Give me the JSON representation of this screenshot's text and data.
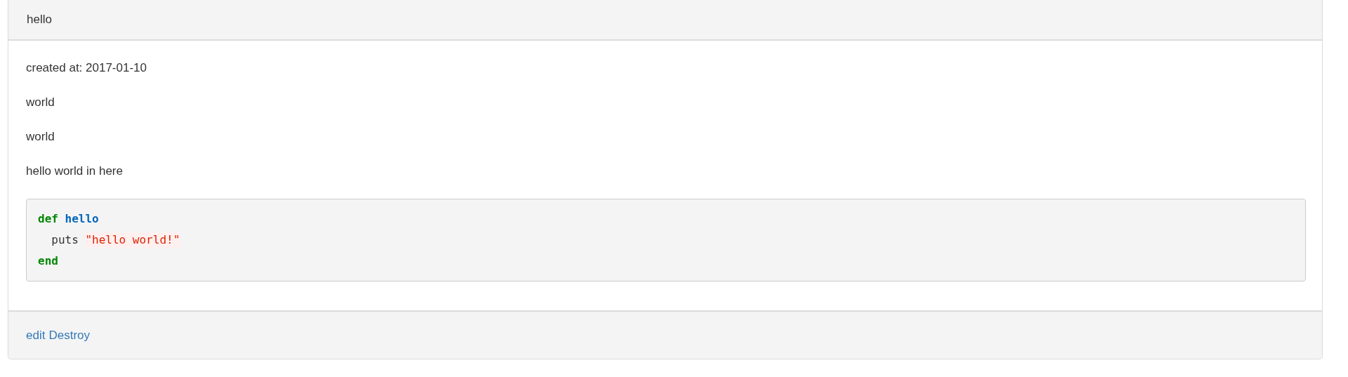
{
  "panel": {
    "title": "hello",
    "lines": [
      "created at: 2017-01-10",
      "world",
      "world",
      "hello world in here"
    ],
    "code": [
      [
        {
          "kind": "keyword",
          "text": "def"
        },
        {
          "kind": "name",
          "text": "hello"
        }
      ],
      [
        {
          "kind": "plain",
          "text": "  puts"
        },
        {
          "kind": "string",
          "text": "\"hello world!\""
        }
      ],
      [
        {
          "kind": "keyword",
          "text": "end"
        }
      ]
    ],
    "footer_links": [
      "edit",
      "Destroy"
    ]
  }
}
